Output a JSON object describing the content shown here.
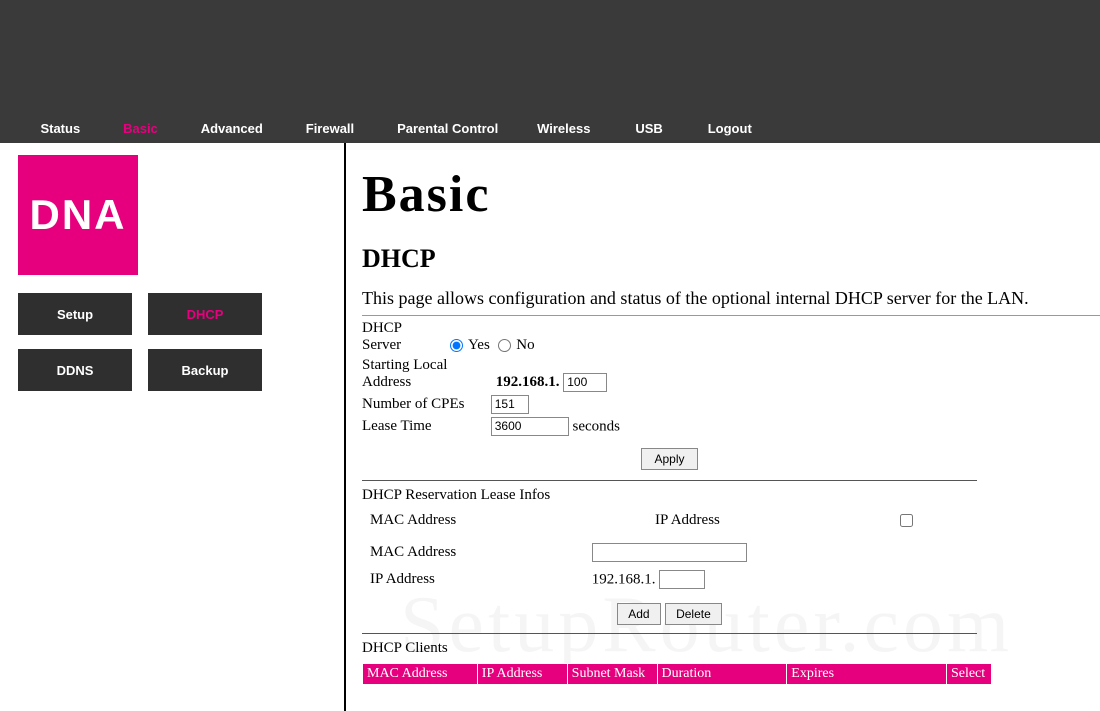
{
  "brand": "DNA",
  "nav": [
    "Status",
    "Basic",
    "Advanced",
    "Firewall",
    "Parental Control",
    "Wireless",
    "USB",
    "Logout"
  ],
  "nav_active": "Basic",
  "subnav": [
    {
      "label": "Setup",
      "active": false
    },
    {
      "label": "DHCP",
      "active": true
    },
    {
      "label": "DDNS",
      "active": false
    },
    {
      "label": "Backup",
      "active": false
    }
  ],
  "page": {
    "title": "Basic",
    "section": "DHCP",
    "description": "This page allows configuration and status of the optional internal DHCP server for the LAN."
  },
  "dhcp": {
    "server_label": "DHCP Server",
    "yes": "Yes",
    "no": "No",
    "server_value": "yes",
    "start_label": "Starting Local Address",
    "start_prefix": "192.168.1.",
    "start_value": "100",
    "cpe_label": "Number of CPEs",
    "cpe_value": "151",
    "lease_label": "Lease Time",
    "lease_value": "3600",
    "lease_unit": "seconds",
    "apply": "Apply"
  },
  "reservation": {
    "title": "DHCP Reservation Lease Infos",
    "col_mac": "MAC Address",
    "col_ip": "IP Address",
    "form_mac_label": "MAC Address",
    "form_mac_value": "",
    "form_ip_label": "IP Address",
    "form_ip_prefix": "192.168.1.",
    "form_ip_value": "",
    "add": "Add",
    "delete": "Delete"
  },
  "clients": {
    "title": "DHCP Clients",
    "headers": [
      "MAC Address",
      "IP Address",
      "Subnet Mask",
      "Duration",
      "Expires",
      "Select"
    ]
  },
  "watermark": "SetupRouter.com"
}
